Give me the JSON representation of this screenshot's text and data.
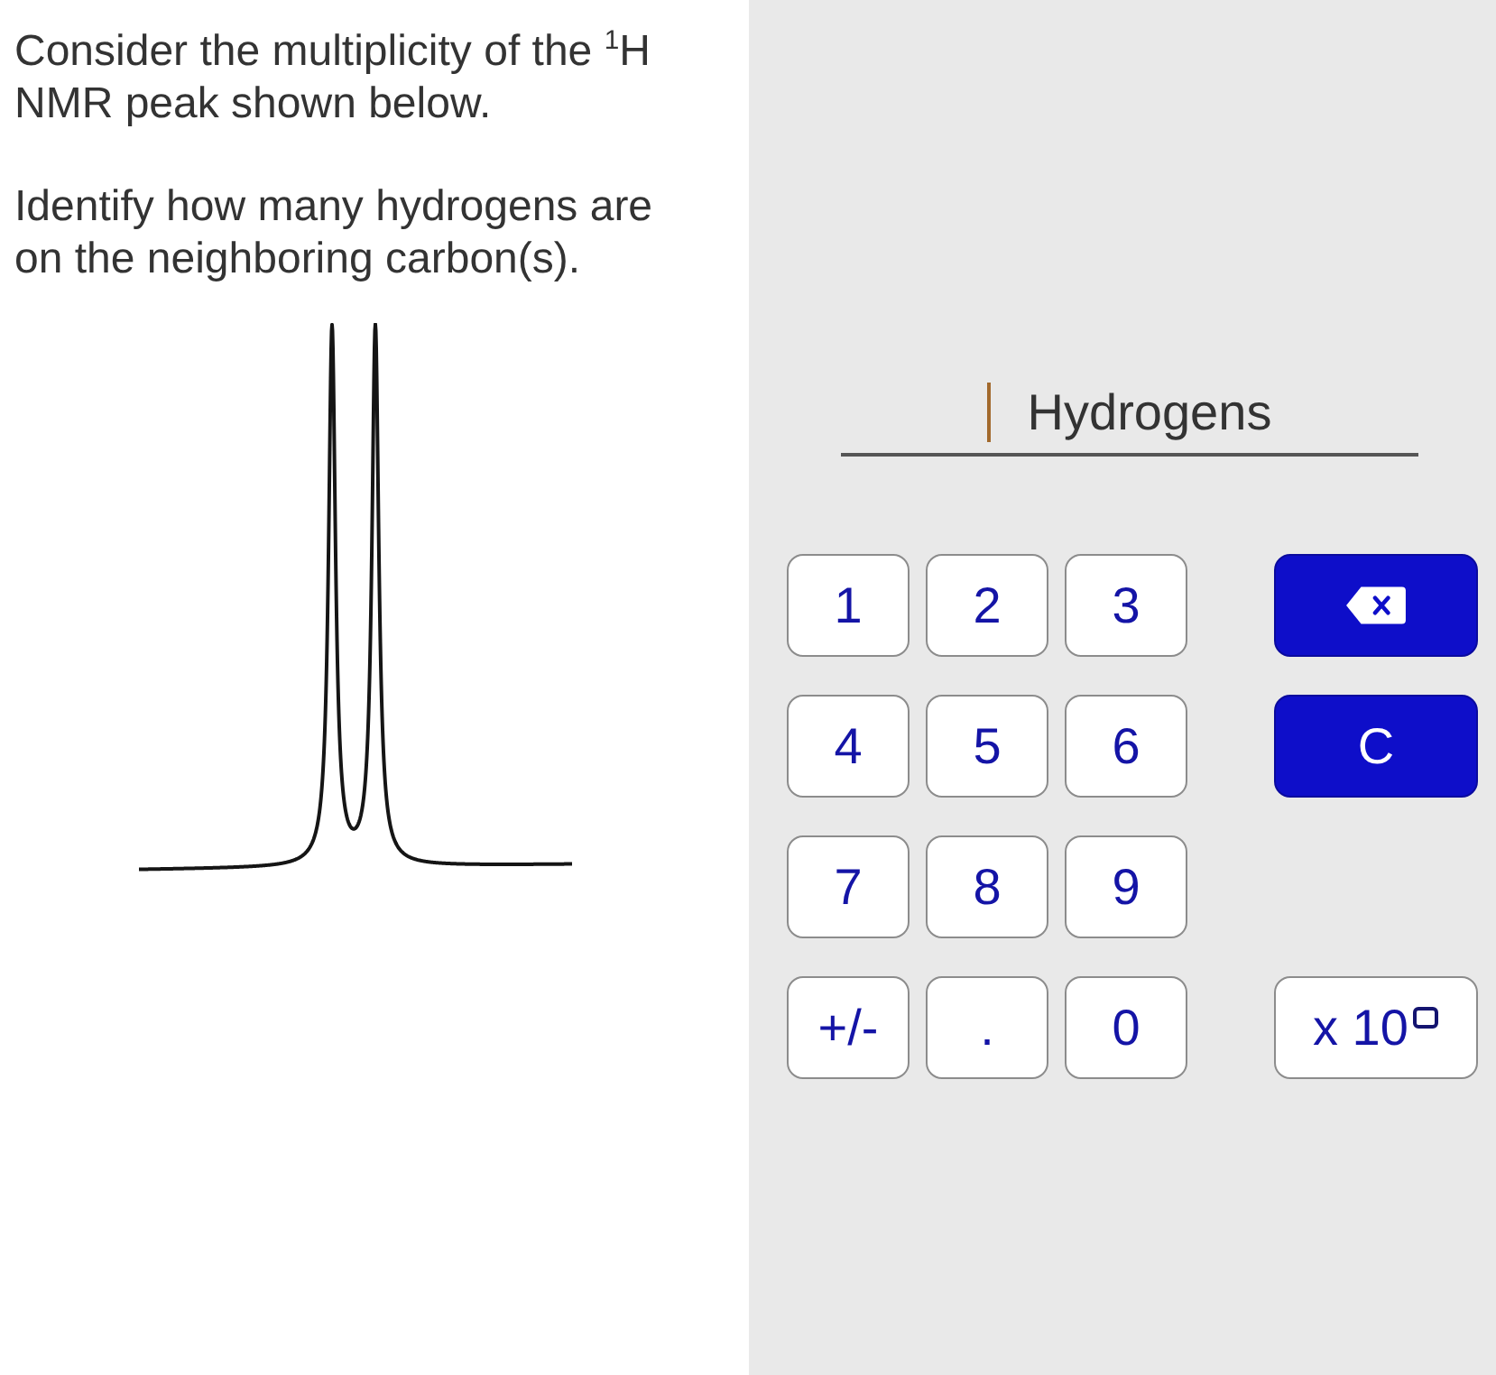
{
  "prompt": {
    "paragraphs": [
      "Consider the multiplicity of the $^{1}$H NMR peak shown below.",
      "Identify how many hydrogens are on the neighboring carbon(s)."
    ]
  },
  "answer": {
    "units": "Hydrogens",
    "focused": true
  },
  "keypad": {
    "number_keys": [
      "1",
      "2",
      "3",
      "4",
      "5",
      "6",
      "7",
      "8",
      "9",
      "+/-",
      ".",
      "0"
    ],
    "side_keys": [
      {
        "kind": "backspace"
      },
      {
        "kind": "clear",
        "label": "C"
      },
      {
        "kind": "exponent",
        "label": "x 10"
      }
    ]
  }
}
